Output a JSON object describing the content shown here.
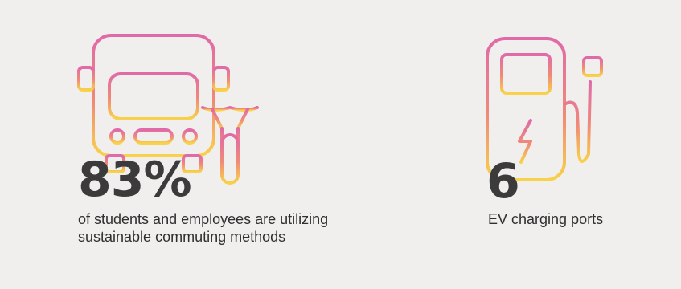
{
  "stats": [
    {
      "icon": "bus-and-bicycle-icon",
      "value": "83%",
      "caption_lines": [
        "of students and employees are utilizing",
        "sustainable commuting methods"
      ]
    },
    {
      "icon": "ev-charging-station-icon",
      "value": "6",
      "caption_lines": [
        "EV charging ports"
      ]
    }
  ],
  "colors": {
    "background": "#f1efee",
    "number": "#3b3b3b",
    "text": "#2f2f2f",
    "gradient_top": "#e06aa8",
    "gradient_mid": "#f08a78",
    "gradient_bottom": "#f7d24a"
  }
}
